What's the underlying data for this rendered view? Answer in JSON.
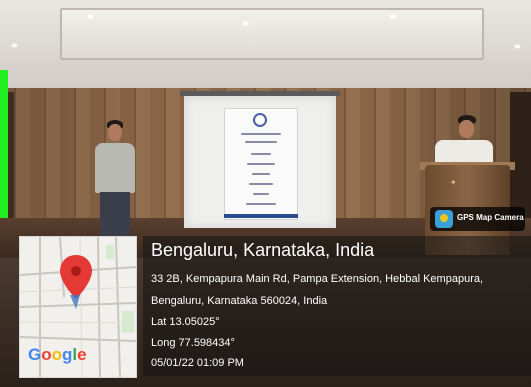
{
  "gps_badge": {
    "label": "GPS Map Camera",
    "icon": "gps-camera-icon"
  },
  "map": {
    "logo": "Google",
    "pin_color": "#e53935",
    "pin_icon": "location-pin-icon"
  },
  "location": {
    "title": "Bengaluru, Karnataka, India",
    "address_line1": "33 2B, Kempapura Main Rd, Pampa Extension, Hebbal Kempapura,",
    "address_line2": "Bengaluru, Karnataka 560024, India",
    "lat": "Lat 13.05025°",
    "long": "Long 77.598434°",
    "datetime": "05/01/22 01:09 PM"
  }
}
